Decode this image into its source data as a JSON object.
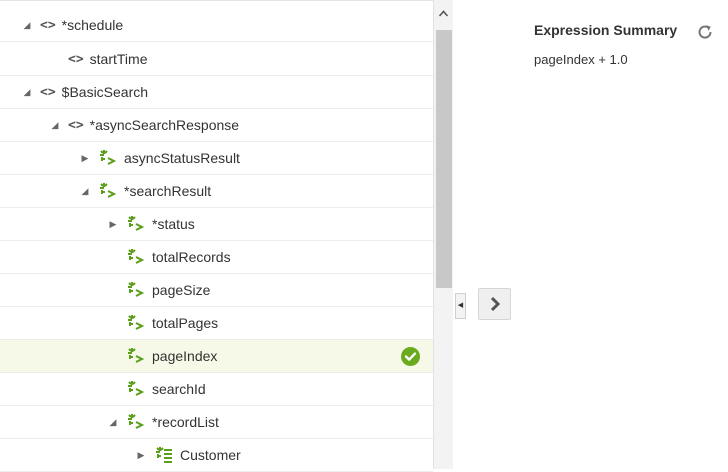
{
  "tree": {
    "rows": [
      {
        "label": "*schedule",
        "toggle": "expanded",
        "icon": "element-icon"
      },
      {
        "label": "startTime",
        "toggle": "none",
        "icon": "element-icon"
      },
      {
        "label": "$BasicSearch",
        "toggle": "expanded",
        "icon": "element-icon"
      },
      {
        "label": "*asyncSearchResponse",
        "toggle": "expanded",
        "icon": "element-icon"
      },
      {
        "label": "asyncStatusResult",
        "toggle": "collapsed",
        "icon": "attribute-icon"
      },
      {
        "label": "*searchResult",
        "toggle": "expanded",
        "icon": "attribute-icon"
      },
      {
        "label": "*status",
        "toggle": "collapsed",
        "icon": "attribute-icon"
      },
      {
        "label": "totalRecords",
        "toggle": "none",
        "icon": "attribute-icon"
      },
      {
        "label": "pageSize",
        "toggle": "none",
        "icon": "attribute-icon"
      },
      {
        "label": "totalPages",
        "toggle": "none",
        "icon": "attribute-icon"
      },
      {
        "label": "pageIndex",
        "toggle": "none",
        "icon": "attribute-icon",
        "selected": true,
        "mapped": true
      },
      {
        "label": "searchId",
        "toggle": "none",
        "icon": "attribute-icon"
      },
      {
        "label": "*recordList",
        "toggle": "expanded",
        "icon": "attribute-icon"
      },
      {
        "label": "Customer",
        "toggle": "collapsed",
        "icon": "collection-icon"
      }
    ]
  },
  "scrollbar": {
    "up_icon": "chevron-up-icon"
  },
  "actions": {
    "move_icon": "chevron-right-icon",
    "collapse_icon": "caret-left-icon"
  },
  "summary": {
    "title": "Expression Summary",
    "refresh_icon": "refresh-icon",
    "expression": "pageIndex + 1.0"
  },
  "colors": {
    "accent_green": "#6aaa1e",
    "selected_row": "#f6f9e8"
  }
}
